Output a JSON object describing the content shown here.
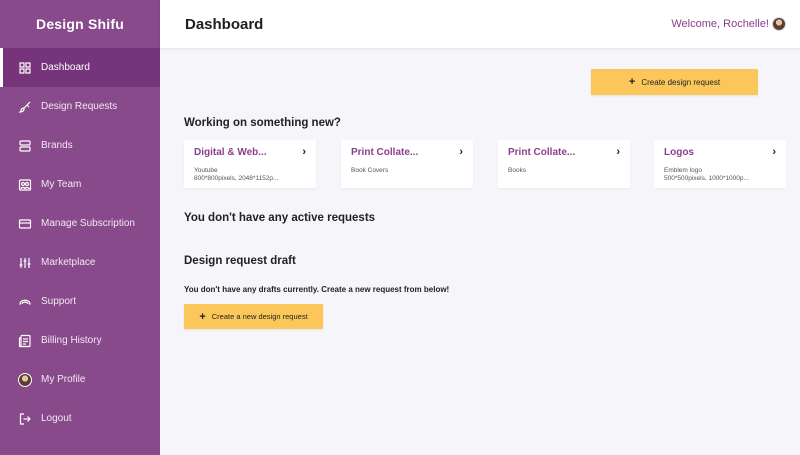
{
  "sidebar": {
    "brand": "Design Shifu",
    "items": [
      {
        "label": "Dashboard",
        "icon": "grid-icon"
      },
      {
        "label": "Design Requests",
        "icon": "brush-icon"
      },
      {
        "label": "Brands",
        "icon": "layers-icon"
      },
      {
        "label": "My Team",
        "icon": "team-icon"
      },
      {
        "label": "Manage Subscription",
        "icon": "card-icon"
      },
      {
        "label": "Marketplace",
        "icon": "sliders-icon"
      },
      {
        "label": "Support",
        "icon": "support-icon"
      },
      {
        "label": "Billing History",
        "icon": "receipt-icon"
      },
      {
        "label": "My Profile",
        "icon": "avatar-icon"
      },
      {
        "label": "Logout",
        "icon": "logout-icon"
      }
    ]
  },
  "header": {
    "title": "Dashboard",
    "welcome": "Welcome, Rochelle!"
  },
  "main": {
    "create_button": "Create design request",
    "working_title": "Working on something new?",
    "cards": [
      {
        "title": "Digital & Web...",
        "subtitle": "Youtube\n800*800pixels, 2048*1152p..."
      },
      {
        "title": "Print Collate...",
        "subtitle": "Book Covers"
      },
      {
        "title": "Print Collate...",
        "subtitle": "Books"
      },
      {
        "title": "Logos",
        "subtitle": "Emblem logo\n500*500pixels, 1000*1000p..."
      }
    ],
    "no_active": "You don't have any active requests",
    "draft_title": "Design request draft",
    "no_drafts": "You don't have any drafts currently. Create a new request from below!",
    "create_new_button": "Create a new design request"
  },
  "colors": {
    "sidebar": "#884a8b",
    "sidebar_active": "#76357a",
    "accent_purple": "#8a3f8c",
    "button_yellow": "#fcc75a",
    "background": "#f6f6fa"
  }
}
